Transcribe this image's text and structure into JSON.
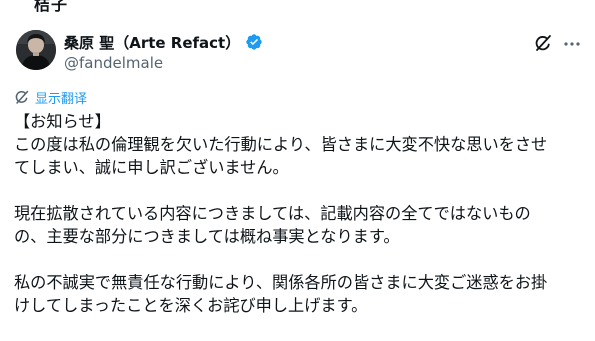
{
  "tweet": {
    "top_fragment": "桔子",
    "author": {
      "display_name": "桑原 聖（Arte Refact）",
      "handle": "@fandelmale"
    },
    "translate_label": "显示翻译",
    "paragraphs": [
      [
        "【お知らせ】",
        "この度は私の倫理観を欠いた行動により、皆さまに大変不快な思いをさせ",
        "てしまい、誠に申し訳ございません。"
      ],
      [
        "現在拡散されている内容につきましては、記載内容の全てではないもの",
        "の、主要な部分につきましては概ね事実となります。"
      ],
      [
        "私の不誠実で無責任な行動により、関係各所の皆さまに大変ご迷惑をお掛",
        "けしてしまったことを深くお詫び申し上げます。"
      ]
    ]
  },
  "icons": {
    "verified": "verified-badge-icon",
    "grok": "grok-icon",
    "more": "more-options-icon",
    "translate": "translate-icon"
  },
  "colors": {
    "text": "#0f1419",
    "secondary": "#536471",
    "accent": "#1d9bf0"
  }
}
